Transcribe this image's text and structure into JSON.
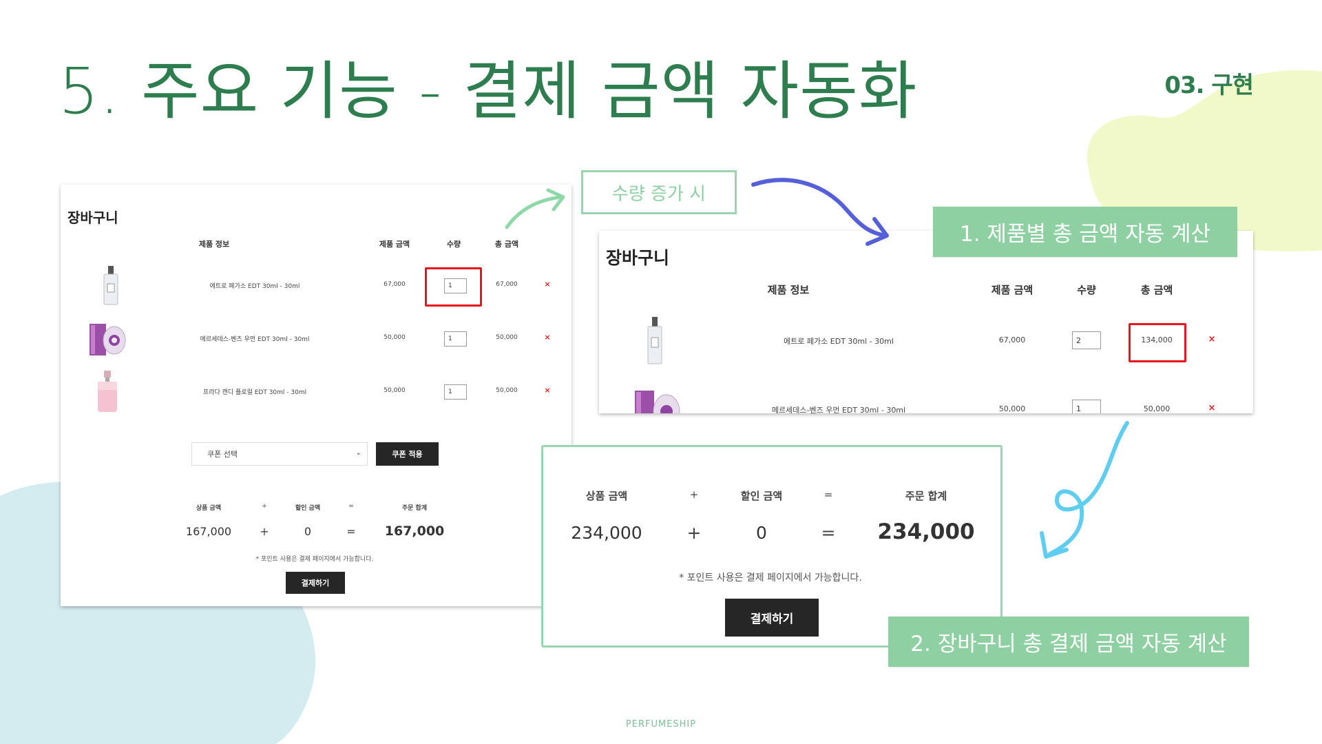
{
  "slide": {
    "title": "5. 주요 기능 - 결제 금액 자동화",
    "section": "03. 구현",
    "footer": "PERFUMESHIP"
  },
  "colors": {
    "title_green": "#2e7d4f",
    "callout_green": "#8ed0a2",
    "outline_green": "#9bd4b0",
    "highlight_red": "#e8141e",
    "arrow_blue": "#5560d8",
    "arrow_cyan": "#5fcdf0",
    "blob_yellow": "#f2f9c8",
    "blob_blue": "#d3ecf0"
  },
  "callouts": {
    "qty_increase": "수량 증가 시",
    "auto_item_total": "1. 제품별 총 금액 자동 계산",
    "auto_cart_total": "2. 장바구니 총 결제 금액 자동 계산"
  },
  "left_cart": {
    "title": "장바구니",
    "headers": {
      "product": "제품 정보",
      "price": "제품 금액",
      "qty": "수량",
      "total": "총 금액"
    },
    "items": [
      {
        "image": "perfume-bottle-clear",
        "name": "에트로 페가소 EDT 30ml - 30ml",
        "price": "67,000",
        "qty": "1",
        "total": "67,000",
        "delete": "×"
      },
      {
        "image": "perfume-box-purple",
        "name": "메르세데스-벤츠 우먼 EDT 30ml - 30ml",
        "price": "50,000",
        "qty": "1",
        "total": "50,000",
        "delete": "×"
      },
      {
        "image": "perfume-bottle-pink",
        "name": "프라다 캔디 플로럴 EDT 30ml - 30ml",
        "price": "50,000",
        "qty": "1",
        "total": "50,000",
        "delete": "×"
      }
    ],
    "coupon": {
      "select": "쿠폰 선택",
      "apply": "쿠폰 적용"
    },
    "summary": {
      "product_label": "상품 금액",
      "discount_label": "할인 금액",
      "order_label": "주문 합계",
      "plus": "+",
      "equals": "=",
      "product_amount": "167,000",
      "discount_amount": "0",
      "order_total": "167,000"
    },
    "note": "* 포인트 사용은 결제 페이지에서 가능합니다.",
    "checkout": "결제하기"
  },
  "right_cart": {
    "title": "장바구니",
    "headers": {
      "product": "제품 정보",
      "price": "제품 금액",
      "qty": "수량",
      "total": "총 금액"
    },
    "items": [
      {
        "image": "perfume-bottle-clear",
        "name": "에트로 페가소 EDT 30ml - 30ml",
        "price": "67,000",
        "qty": "2",
        "total": "134,000",
        "delete": "×"
      },
      {
        "image": "perfume-box-purple",
        "name": "메르세데스-벤즈 우먼 EDT 30ml - 30ml",
        "price": "50,000",
        "qty": "1",
        "total": "50,000",
        "delete": "×"
      }
    ]
  },
  "zoom_summary": {
    "product_label": "상품 금액",
    "discount_label": "할인 금액",
    "order_label": "주문 합계",
    "plus": "+",
    "equals": "=",
    "product_amount": "234,000",
    "discount_amount": "0",
    "order_total": "234,000",
    "note": "* 포인트 사용은 결제 페이지에서 가능합니다.",
    "checkout": "결제하기"
  }
}
